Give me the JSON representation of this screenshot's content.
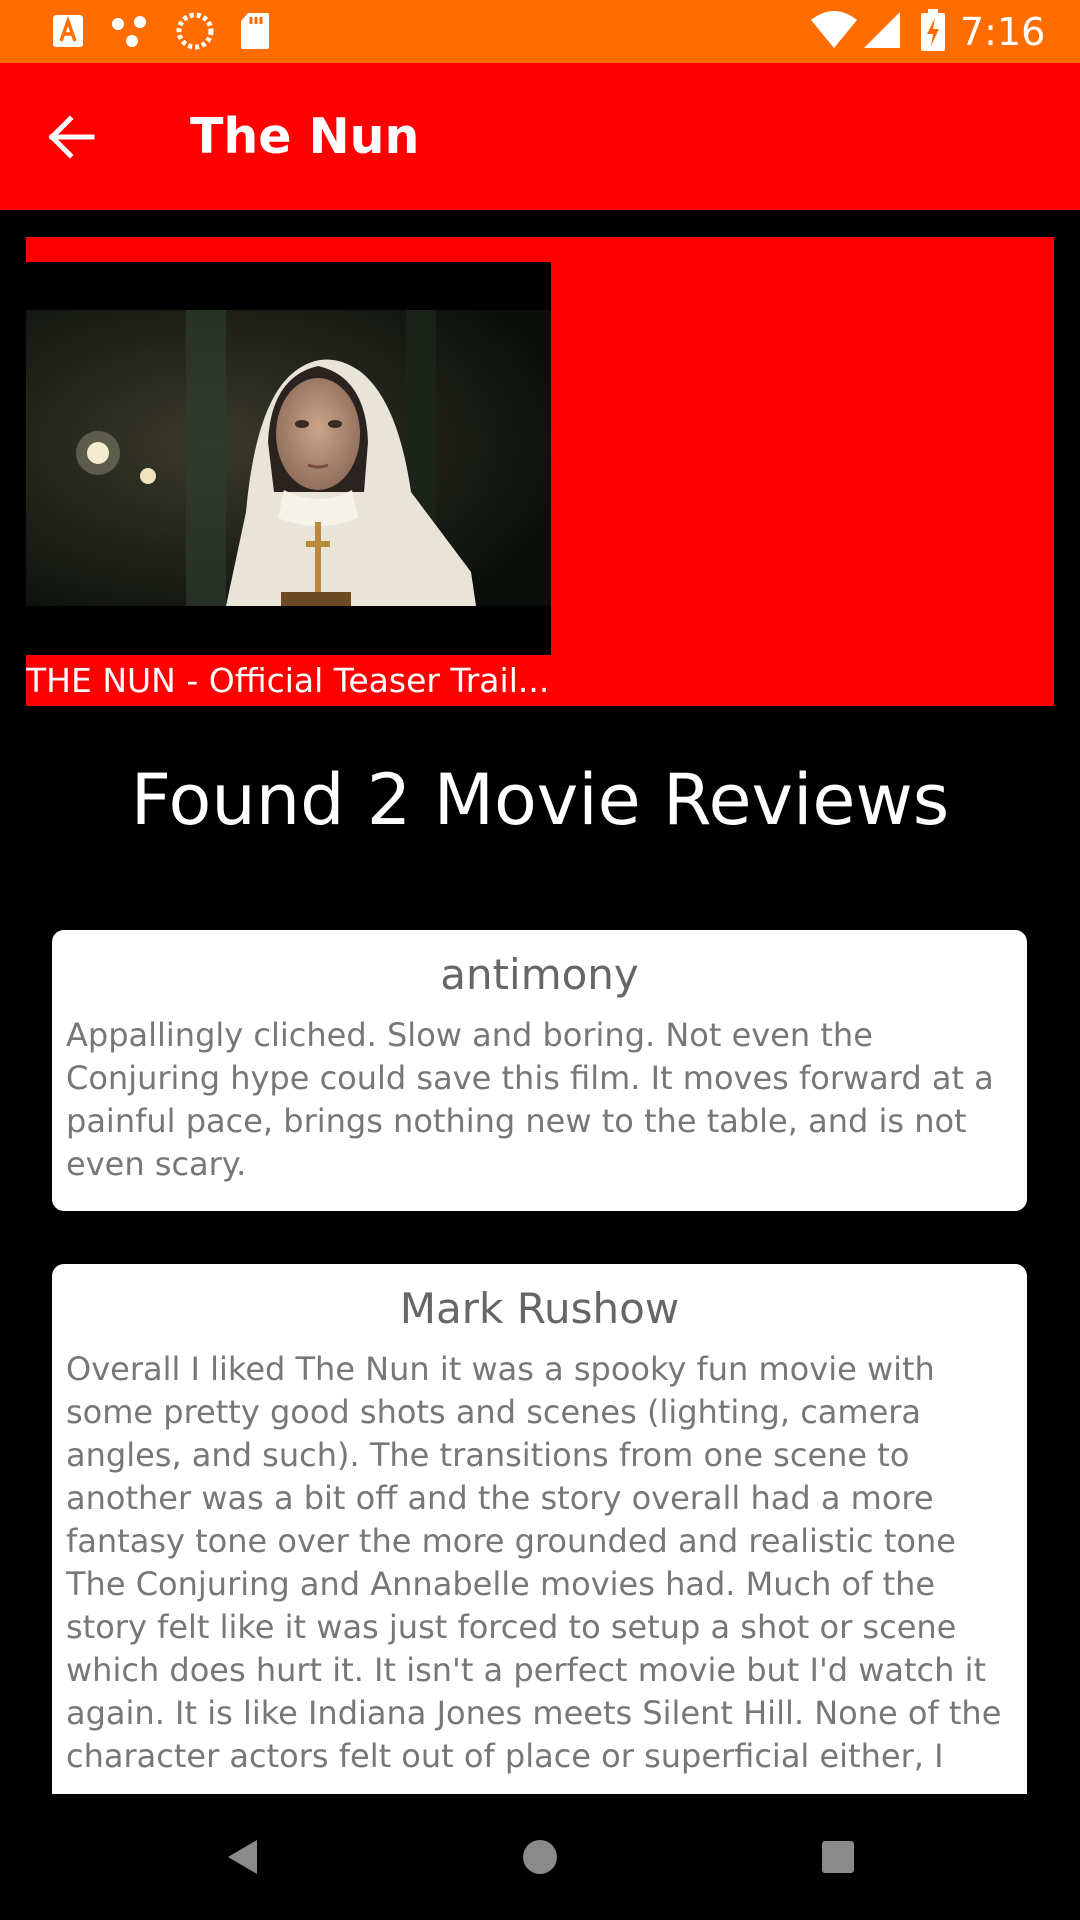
{
  "status_bar": {
    "time": "7:16",
    "icons": [
      "notification-a-icon",
      "dots-icon",
      "sync-icon",
      "sd-card-icon",
      "wifi-icon",
      "signal-icon",
      "battery-charging-icon"
    ],
    "color": "#ff6d00"
  },
  "app_bar": {
    "title": "The Nun",
    "back_icon": "arrow-left-icon",
    "color": "#ff0000"
  },
  "trailer": {
    "title": "THE NUN - Official Teaser Trail...",
    "panel_color": "#ff0000"
  },
  "reviews": {
    "heading": "Found 2 Movie Reviews",
    "items": [
      {
        "author": "antimony",
        "content": "Appallingly cliched. Slow and boring. Not even the Conjuring hype could save this film. It moves forward at a painful pace, brings nothing new to the table, and is not even scary."
      },
      {
        "author": "Mark Rushow",
        "content": "Overall I liked The Nun it was a spooky fun movie with some pretty good shots and scenes (lighting, camera angles, and such). The transitions from one scene to another was a bit off and the story overall had a more fantasy tone over the more grounded and realistic tone The Conjuring and Annabelle movies had. Much of the story felt like it was just forced to setup a shot or scene which does hurt it. It isn't a perfect movie but I'd watch it again. It is like Indiana Jones meets Silent Hill. None of the character actors felt out of place or superficial either, I"
      }
    ]
  },
  "nav_bar": {
    "icons": [
      "back-triangle-icon",
      "home-circle-icon",
      "recents-square-icon"
    ]
  }
}
